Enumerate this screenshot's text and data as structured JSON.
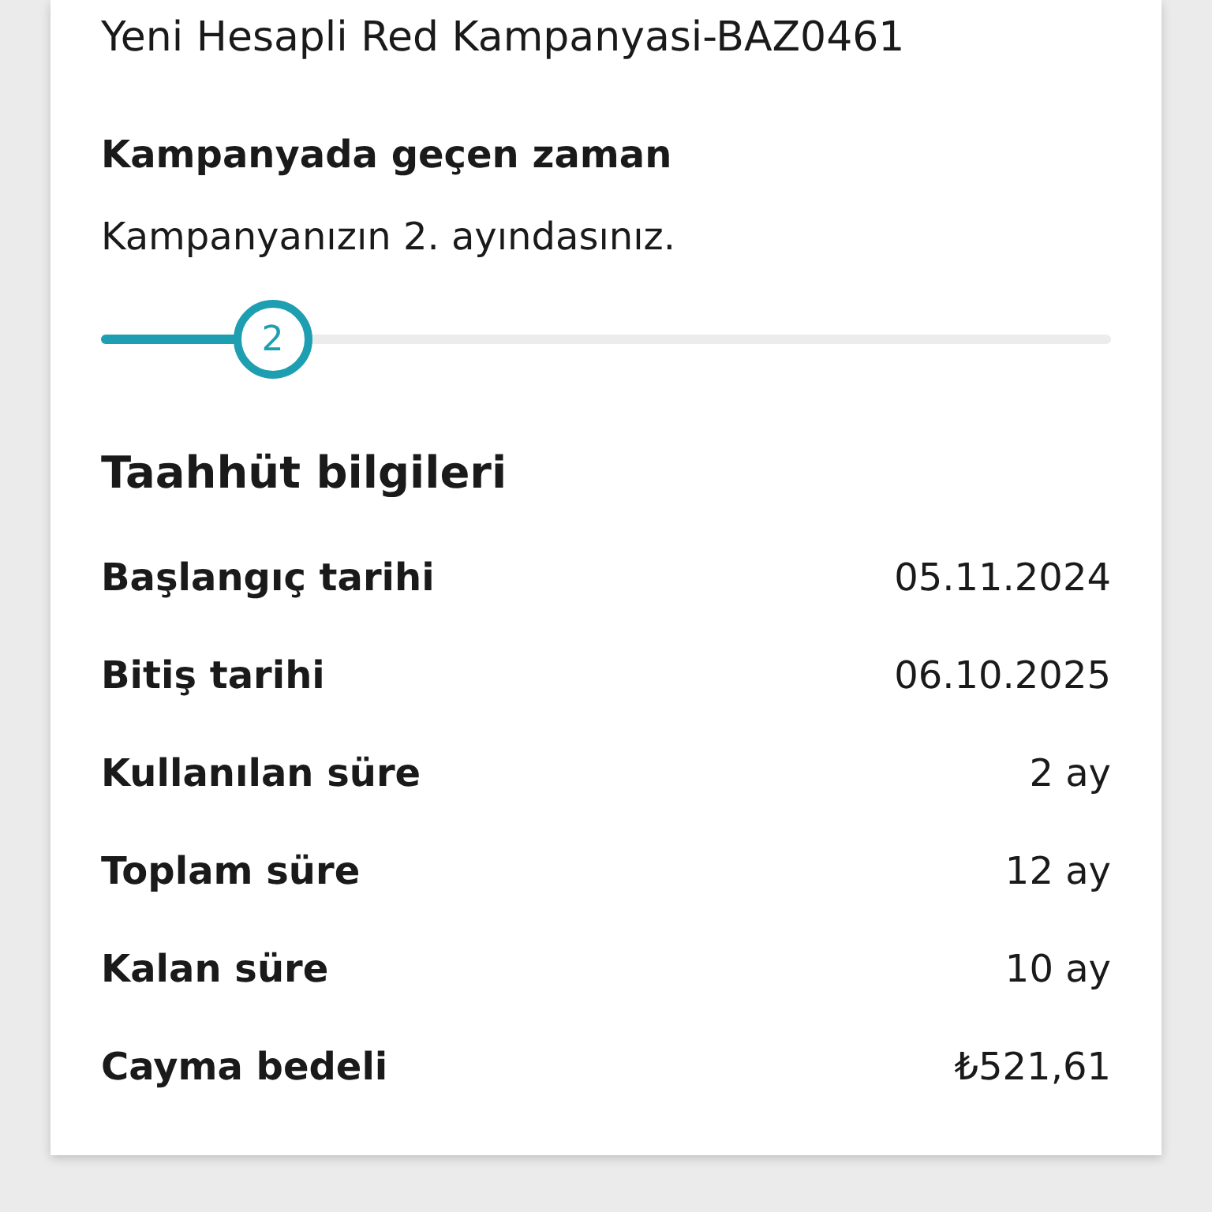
{
  "campaign_name": "Yeni Hesapli Red Kampanyasi-BAZ0461",
  "elapsed": {
    "title": "Kampanyada geçen zaman",
    "subtitle": "Kampanyanızın 2. ayındasınız.",
    "thumb_label": "2",
    "level": 0.17
  },
  "commitment": {
    "title": "Taahhüt bilgileri",
    "rows": [
      {
        "label": "Başlangıç tarihi",
        "value": "05.11.2024"
      },
      {
        "label": "Bitiş tarihi",
        "value": "06.10.2025"
      },
      {
        "label": "Kullanılan süre",
        "value": "2 ay"
      },
      {
        "label": "Toplam süre",
        "value": "12 ay"
      },
      {
        "label": "Kalan süre",
        "value": "10 ay"
      },
      {
        "label": "Cayma bedeli",
        "value": "₺521,61"
      }
    ]
  }
}
